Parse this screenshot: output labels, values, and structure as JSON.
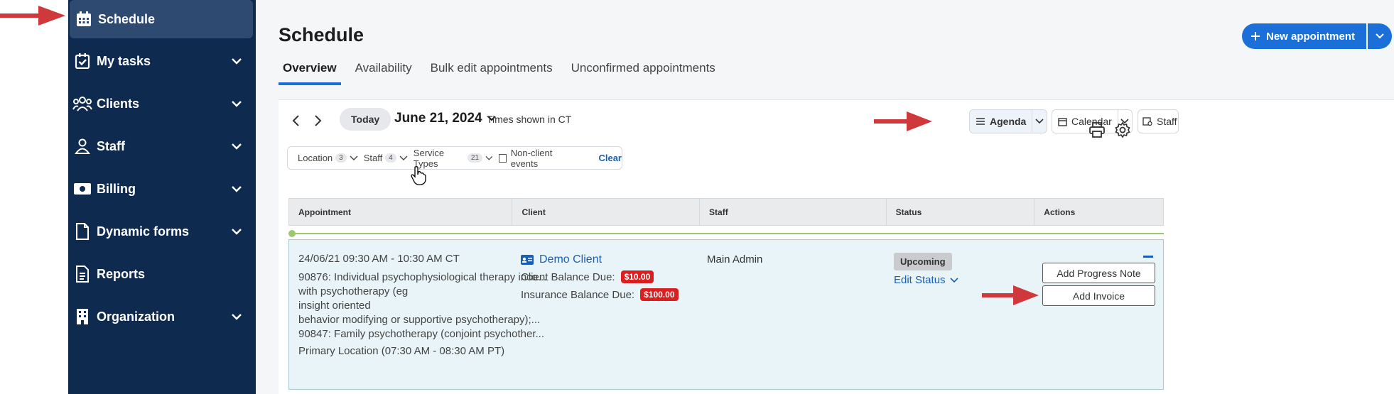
{
  "sidebar": {
    "items": [
      {
        "label": "Schedule",
        "icon": "calendar-icon"
      },
      {
        "label": "My tasks",
        "icon": "task-check-icon"
      },
      {
        "label": "Clients",
        "icon": "clients-group-icon"
      },
      {
        "label": "Staff",
        "icon": "staff-person-icon"
      },
      {
        "label": "Billing",
        "icon": "billing-cash-icon"
      },
      {
        "label": "Dynamic forms",
        "icon": "document-icon"
      },
      {
        "label": "Reports",
        "icon": "report-icon"
      },
      {
        "label": "Organization",
        "icon": "building-icon"
      }
    ]
  },
  "header": {
    "title": "Schedule",
    "tabs": [
      "Overview",
      "Availability",
      "Bulk edit appointments",
      "Unconfirmed appointments"
    ],
    "new_appointment_label": "New appointment"
  },
  "toolbar": {
    "today_label": "Today",
    "date": "June 21, 2024",
    "timezone_note": "Times shown in CT",
    "views": {
      "agenda": "Agenda",
      "calendar": "Calendar",
      "staff": "Staff"
    }
  },
  "filters": {
    "location": {
      "label": "Location",
      "count": "3"
    },
    "staff": {
      "label": "Staff",
      "count": "4"
    },
    "service_types": {
      "label": "Service Types",
      "count": "21"
    },
    "non_client_events": "Non-client events",
    "clear": "Clear"
  },
  "table": {
    "headers": [
      "Appointment",
      "Client",
      "Staff",
      "Status",
      "Actions"
    ],
    "row": {
      "datetime": "24/06/21 09:30 AM - 10:30 AM CT",
      "service_lines": [
        "90876: Individual psychophysiological therapy inco...",
        "with psychotherapy (eg",
        "insight oriented",
        "behavior modifying or supportive psychotherapy);...",
        "90847: Family psychotherapy (conjoint psychother..."
      ],
      "location": "Primary Location  (07:30 AM - 08:30 AM PT)",
      "client_name": "Demo Client",
      "client_balance_label": "Client Balance Due:",
      "client_balance": "$10.00",
      "insurance_balance_label": "Insurance Balance Due:",
      "insurance_balance": "$100.00",
      "staff": "Main Admin",
      "status": "Upcoming",
      "edit_status": "Edit Status",
      "actions": [
        "Add Progress Note",
        "Add Invoice"
      ]
    }
  },
  "colors": {
    "sidebar_bg": "#0e2a4f",
    "accent_blue": "#1a6fd8",
    "annotation_red": "#d0393b",
    "row_bg": "#e8f4f7",
    "badge_red": "#d91f1f"
  }
}
